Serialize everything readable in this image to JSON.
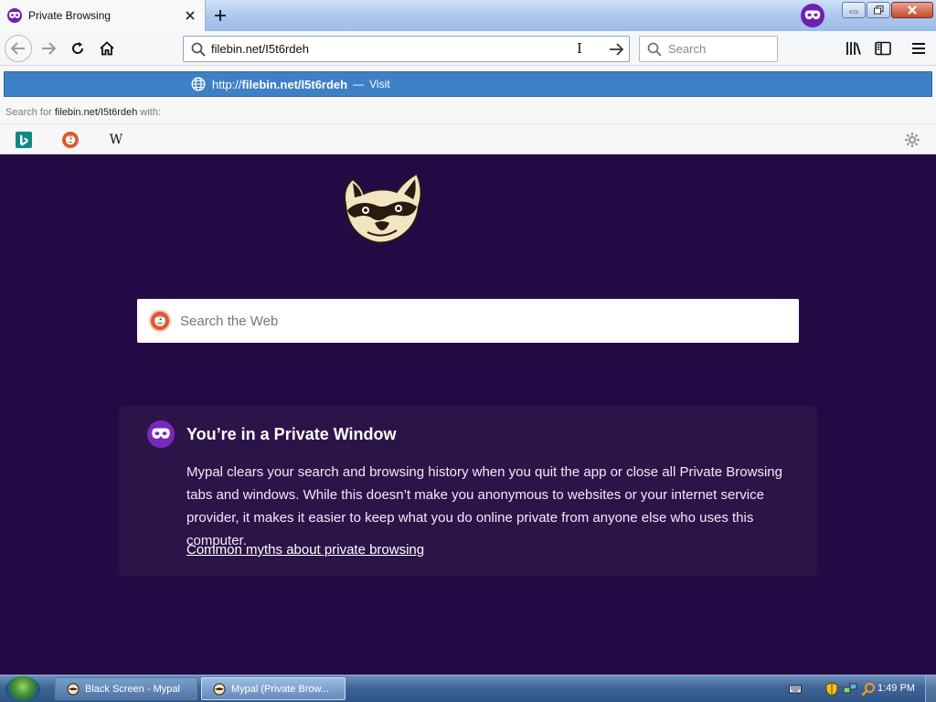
{
  "browser": {
    "tab_title": "Private Browsing",
    "url_text": "filebin.net/I5t6rdeh",
    "search_placeholder": "Search"
  },
  "popup": {
    "url_proto": "http://",
    "url_host": "filebin.net/I5t6rdeh",
    "separator": "—",
    "action": "Visit",
    "search_with_prefix": "Search for",
    "search_with_query": "filebin.net/I5t6rdeh",
    "search_with_suffix": "with:",
    "engines": [
      "bing",
      "duckduckgo",
      "wikipedia"
    ],
    "wiki_glyph": "W"
  },
  "page": {
    "search_placeholder": "Search the Web",
    "card_title": "You’re in a Private Window",
    "card_body": "Mypal clears your search and browsing history when you quit the app or close all Private Browsing tabs and windows. While this doesn’t make you anonymous to websites or your internet service provider, it makes it easier to keep what you do online private from anyone else who uses this computer.",
    "card_link": "Common myths about private browsing"
  },
  "taskbar": {
    "items": [
      {
        "label": "Black Screen - Mypal",
        "active": false
      },
      {
        "label": "Mypal (Private Brow...",
        "active": true
      }
    ],
    "clock": "1:49 PM"
  },
  "colors": {
    "page_bg": "#240a44",
    "card_bg": "#2d1448",
    "private_purple": "#6f1fb4",
    "selection_blue": "#3d80c6"
  }
}
